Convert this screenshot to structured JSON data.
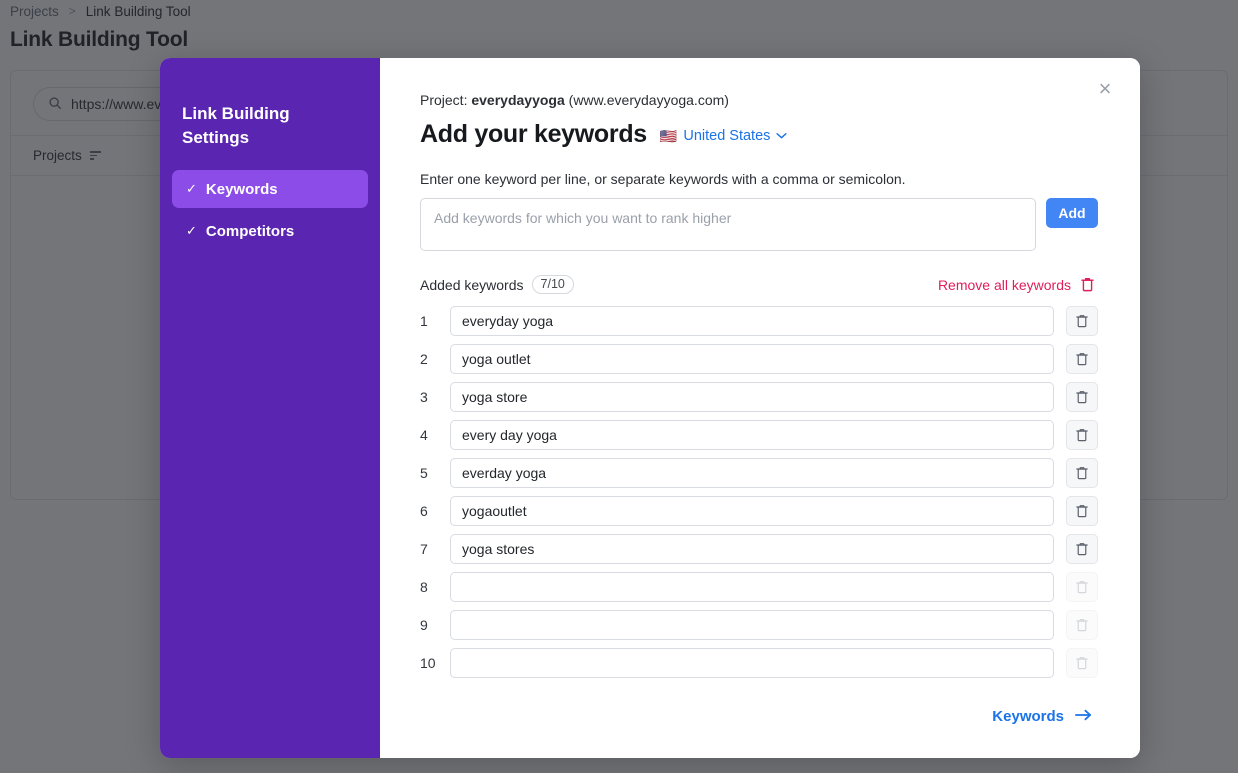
{
  "background": {
    "breadcrumb": {
      "root": "Projects",
      "separator": ">",
      "current": "Link Building Tool"
    },
    "page_title": "Link Building Tool",
    "search": {
      "value": "https://www.ev",
      "icon": "search-icon"
    },
    "table_header": {
      "label": "Projects",
      "icon": "sort-icon"
    }
  },
  "modal": {
    "close_icon": "×",
    "sidebar": {
      "title": "Link Building Settings",
      "items": [
        {
          "label": "Keywords",
          "check": "✓",
          "active": true
        },
        {
          "label": "Competitors",
          "check": "✓",
          "active": false
        }
      ]
    },
    "project": {
      "prefix": "Project:",
      "name": "everydayyoga",
      "domain": "(www.everydayyoga.com)"
    },
    "heading": "Add your keywords",
    "country": {
      "flag": "🇺🇸",
      "label": "United States",
      "chevron": "⌄"
    },
    "hint": "Enter one keyword per line, or separate keywords with a comma or semicolon.",
    "entry": {
      "placeholder": "Add keywords for which you want to rank higher",
      "value": "",
      "add_label": "Add"
    },
    "added": {
      "label": "Added keywords",
      "counter": "7/10",
      "remove_all_label": "Remove all keywords",
      "remove_all_icon": "trash-icon"
    },
    "keywords": [
      {
        "num": "1",
        "value": "everyday yoga",
        "filled": true
      },
      {
        "num": "2",
        "value": "yoga outlet",
        "filled": true
      },
      {
        "num": "3",
        "value": "yoga store",
        "filled": true
      },
      {
        "num": "4",
        "value": "every day yoga",
        "filled": true
      },
      {
        "num": "5",
        "value": "everday yoga",
        "filled": true
      },
      {
        "num": "6",
        "value": "yogaoutlet",
        "filled": true
      },
      {
        "num": "7",
        "value": "yoga stores",
        "filled": true
      },
      {
        "num": "8",
        "value": "",
        "filled": false
      },
      {
        "num": "9",
        "value": "",
        "filled": false
      },
      {
        "num": "10",
        "value": "",
        "filled": false
      }
    ],
    "footer": {
      "next_label": "Keywords",
      "next_arrow": "→"
    }
  },
  "colors": {
    "sidebar_purple": "#5a25b0",
    "sidebar_active": "#8b4ce8",
    "accent_blue": "#1a73e8",
    "add_button_blue": "#4285f4",
    "danger_red": "#e01e5a"
  }
}
